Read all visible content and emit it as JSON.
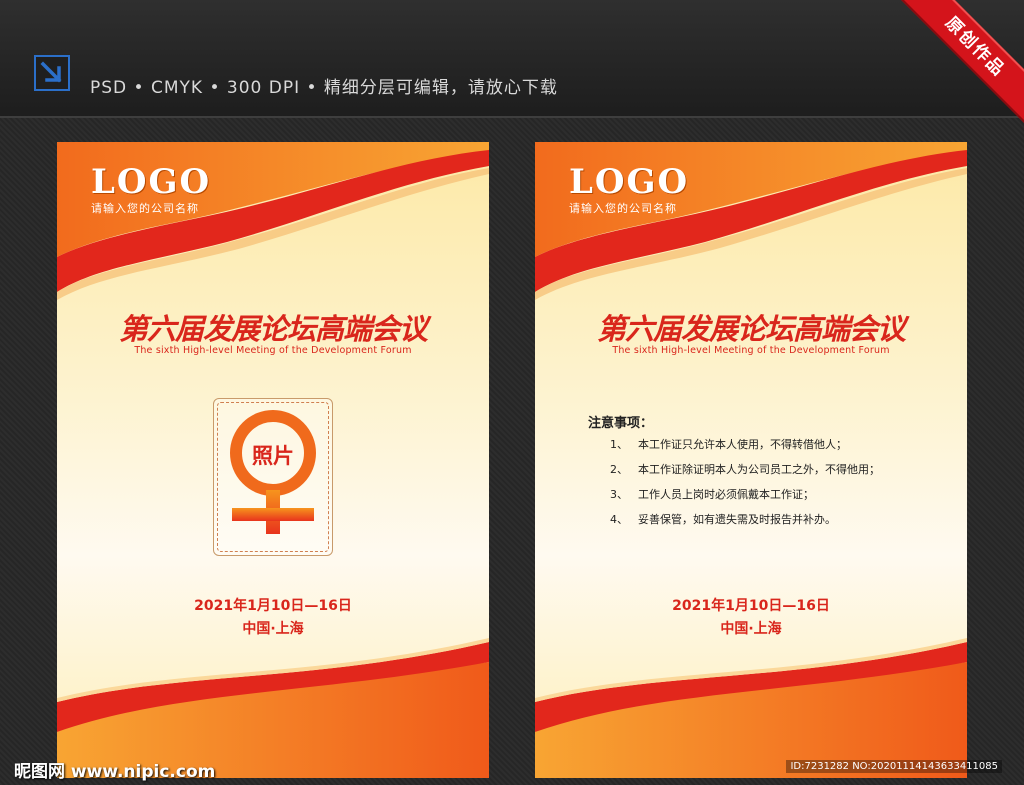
{
  "header": {
    "spec": "PSD • CMYK • 300 DPI • 精细分层可编辑，请放心下载",
    "ribbon": "原创作品",
    "icon": "download-arrow-icon"
  },
  "card_left": {
    "logo": "LOGO",
    "company": "请输入您的公司名称",
    "title": "第六届发展论坛高端会议",
    "subtitle": "The sixth High-level Meeting of the Development Forum",
    "photo_label": "照片",
    "date": "2021年1月10日—16日",
    "place": "中国·上海"
  },
  "card_right": {
    "logo": "LOGO",
    "company": "请输入您的公司名称",
    "title": "第六届发展论坛高端会议",
    "subtitle": "The sixth High-level Meeting of the Development Forum",
    "notes_title": "注意事项：",
    "notes": [
      {
        "num": "1、",
        "text": "本工作证只允许本人使用，不得转借他人；"
      },
      {
        "num": "2、",
        "text": "本工作证除证明本人为公司员工之外，不得他用；"
      },
      {
        "num": "3、",
        "text": "工作人员上岗时必须佩戴本工作证；"
      },
      {
        "num": "4、",
        "text": "妥善保管，如有遗失需及时报告并补办。"
      }
    ],
    "date": "2021年1月10日—16日",
    "place": "中国·上海"
  },
  "watermark": {
    "site": "昵图网 www.nipic.com",
    "id": "ID:7231282 NO:20201114143633411085"
  },
  "colors": {
    "accent_red": "#d9261c",
    "orange": "#f7941d",
    "ribbon": "#d4141b"
  }
}
